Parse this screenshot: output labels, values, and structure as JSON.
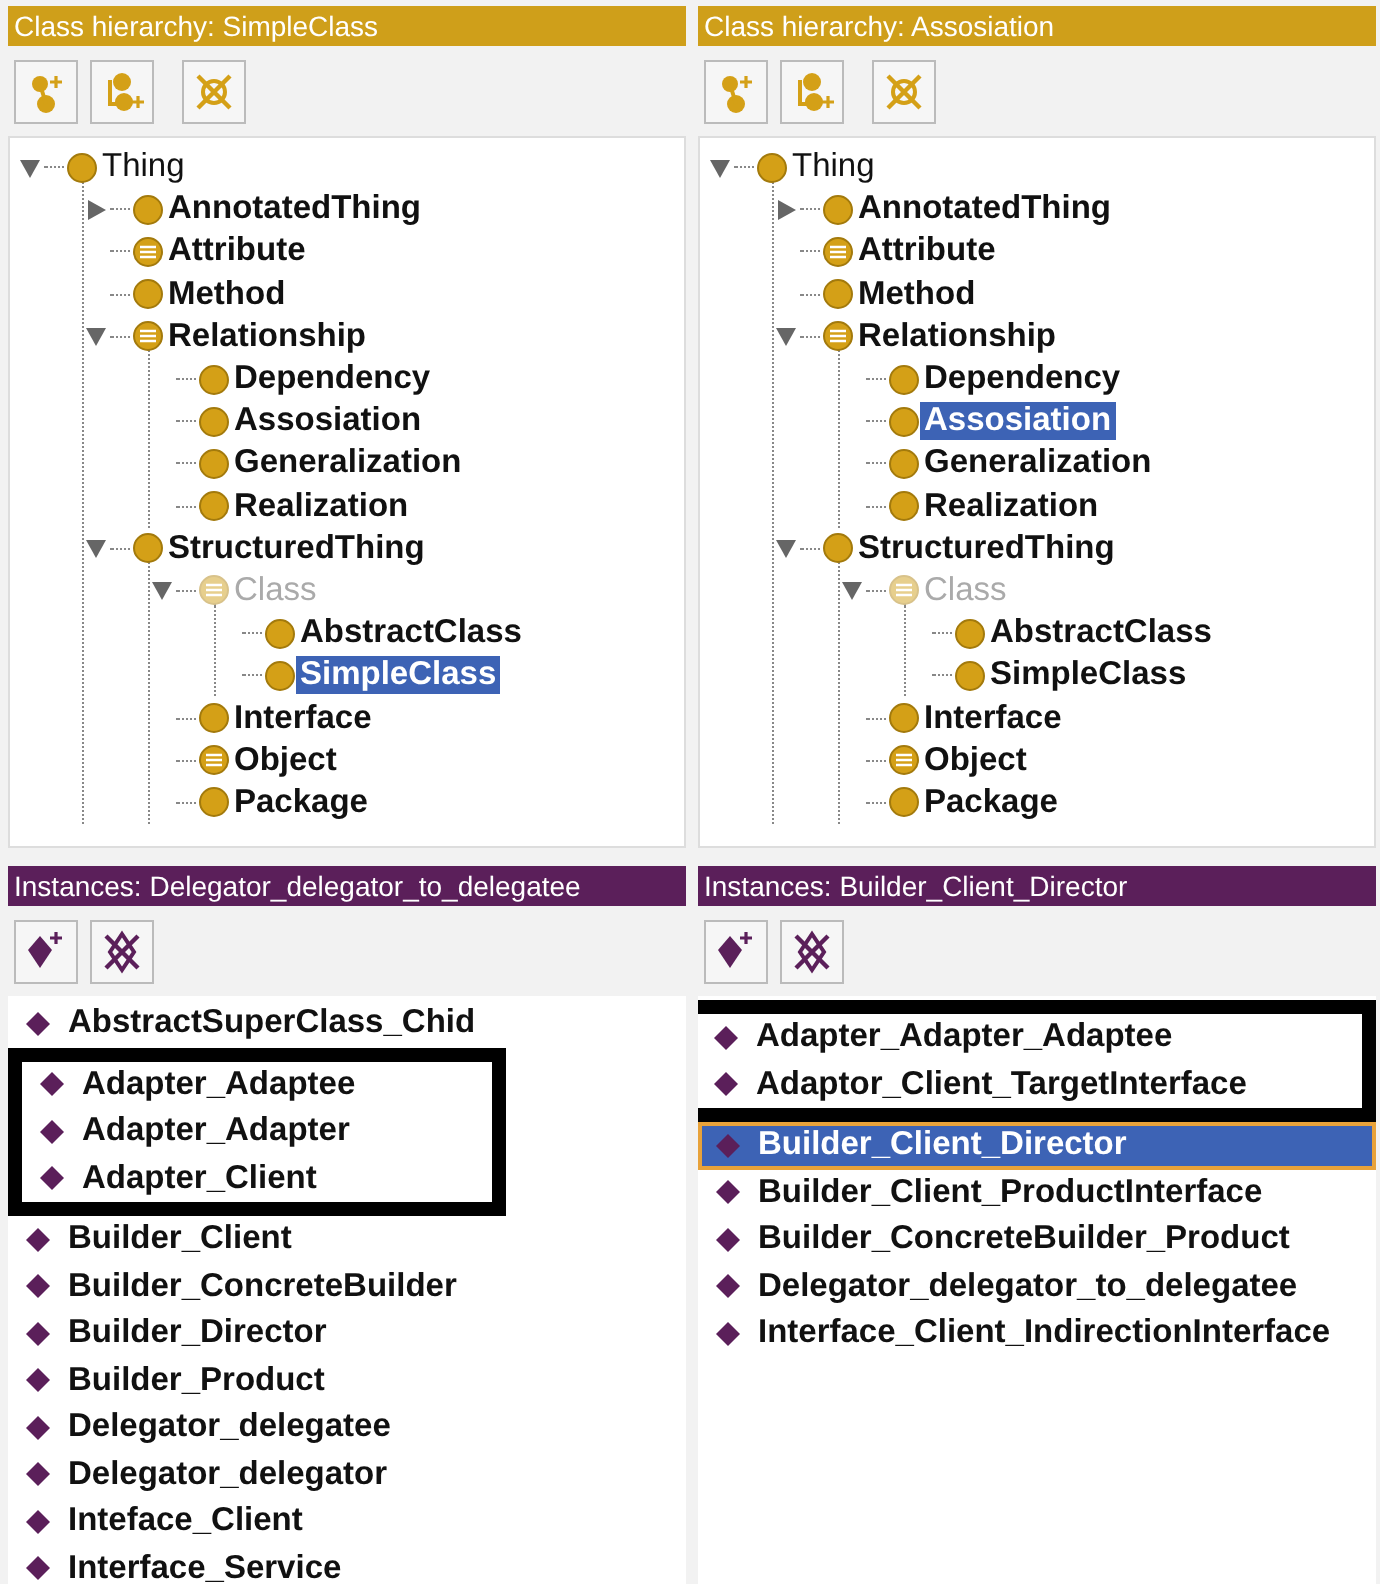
{
  "hierarchy_panels": [
    {
      "title": "Class hierarchy: SimpleClass",
      "tree": [
        {
          "label": "Thing",
          "kind": "class",
          "bold": false,
          "expanded": true,
          "selected": false,
          "greyed": false,
          "children": [
            {
              "label": "AnnotatedThing",
              "kind": "class",
              "bold": true,
              "expanded": false,
              "selected": false,
              "greyed": false
            },
            {
              "label": "Attribute",
              "kind": "defined",
              "bold": true,
              "selected": false,
              "greyed": false
            },
            {
              "label": "Method",
              "kind": "class",
              "bold": true,
              "selected": false,
              "greyed": false
            },
            {
              "label": "Relationship",
              "kind": "defined",
              "bold": true,
              "expanded": true,
              "selected": false,
              "greyed": false,
              "children": [
                {
                  "label": "Dependency",
                  "kind": "class",
                  "bold": true,
                  "selected": false,
                  "greyed": false
                },
                {
                  "label": "Assosiation",
                  "kind": "class",
                  "bold": true,
                  "selected": false,
                  "greyed": false
                },
                {
                  "label": "Generalization",
                  "kind": "class",
                  "bold": true,
                  "selected": false,
                  "greyed": false
                },
                {
                  "label": "Realization",
                  "kind": "class",
                  "bold": true,
                  "selected": false,
                  "greyed": false
                }
              ]
            },
            {
              "label": "StructuredThing",
              "kind": "class",
              "bold": true,
              "expanded": true,
              "selected": false,
              "greyed": false,
              "children": [
                {
                  "label": "Class",
                  "kind": "defined",
                  "bold": false,
                  "expanded": true,
                  "selected": false,
                  "greyed": true,
                  "children": [
                    {
                      "label": "AbstractClass",
                      "kind": "class",
                      "bold": true,
                      "selected": false,
                      "greyed": false
                    },
                    {
                      "label": "SimpleClass",
                      "kind": "class",
                      "bold": true,
                      "selected": true,
                      "greyed": false
                    }
                  ]
                },
                {
                  "label": "Interface",
                  "kind": "class",
                  "bold": true,
                  "selected": false,
                  "greyed": false
                },
                {
                  "label": "Object",
                  "kind": "defined",
                  "bold": true,
                  "selected": false,
                  "greyed": false
                },
                {
                  "label": "Package",
                  "kind": "class",
                  "bold": true,
                  "selected": false,
                  "greyed": false
                }
              ]
            }
          ]
        }
      ]
    },
    {
      "title": "Class hierarchy: Assosiation",
      "tree": [
        {
          "label": "Thing",
          "kind": "class",
          "bold": false,
          "expanded": true,
          "selected": false,
          "greyed": false,
          "children": [
            {
              "label": "AnnotatedThing",
              "kind": "class",
              "bold": true,
              "expanded": false,
              "selected": false,
              "greyed": false
            },
            {
              "label": "Attribute",
              "kind": "defined",
              "bold": true,
              "selected": false,
              "greyed": false
            },
            {
              "label": "Method",
              "kind": "class",
              "bold": true,
              "selected": false,
              "greyed": false
            },
            {
              "label": "Relationship",
              "kind": "defined",
              "bold": true,
              "expanded": true,
              "selected": false,
              "greyed": false,
              "children": [
                {
                  "label": "Dependency",
                  "kind": "class",
                  "bold": true,
                  "selected": false,
                  "greyed": false
                },
                {
                  "label": "Assosiation",
                  "kind": "class",
                  "bold": true,
                  "selected": true,
                  "greyed": false
                },
                {
                  "label": "Generalization",
                  "kind": "class",
                  "bold": true,
                  "selected": false,
                  "greyed": false
                },
                {
                  "label": "Realization",
                  "kind": "class",
                  "bold": true,
                  "selected": false,
                  "greyed": false
                }
              ]
            },
            {
              "label": "StructuredThing",
              "kind": "class",
              "bold": true,
              "expanded": true,
              "selected": false,
              "greyed": false,
              "children": [
                {
                  "label": "Class",
                  "kind": "defined",
                  "bold": false,
                  "expanded": true,
                  "selected": false,
                  "greyed": true,
                  "children": [
                    {
                      "label": "AbstractClass",
                      "kind": "class",
                      "bold": true,
                      "selected": false,
                      "greyed": false
                    },
                    {
                      "label": "SimpleClass",
                      "kind": "class",
                      "bold": true,
                      "selected": false,
                      "greyed": false
                    }
                  ]
                },
                {
                  "label": "Interface",
                  "kind": "class",
                  "bold": true,
                  "selected": false,
                  "greyed": false
                },
                {
                  "label": "Object",
                  "kind": "defined",
                  "bold": true,
                  "selected": false,
                  "greyed": false
                },
                {
                  "label": "Package",
                  "kind": "class",
                  "bold": true,
                  "selected": false,
                  "greyed": false
                }
              ]
            }
          ]
        }
      ]
    }
  ],
  "instance_panels": [
    {
      "title": "Instances: Delegator_delegator_to_delegatee",
      "items": [
        {
          "label": "AbstractSuperClass_Chid",
          "selected": false,
          "framed": false
        },
        {
          "label": "Adapter_Adaptee",
          "selected": false,
          "framed": true
        },
        {
          "label": "Adapter_Adapter",
          "selected": false,
          "framed": true
        },
        {
          "label": "Adapter_Client",
          "selected": false,
          "framed": true
        },
        {
          "label": "Builder_Client",
          "selected": false,
          "framed": false
        },
        {
          "label": "Builder_ConcreteBuilder",
          "selected": false,
          "framed": false
        },
        {
          "label": "Builder_Director",
          "selected": false,
          "framed": false
        },
        {
          "label": "Builder_Product",
          "selected": false,
          "framed": false
        },
        {
          "label": "Delegator_delegatee",
          "selected": false,
          "framed": false
        },
        {
          "label": "Delegator_delegator",
          "selected": false,
          "framed": false
        },
        {
          "label": "Inteface_Client",
          "selected": false,
          "framed": false
        },
        {
          "label": "Interface_Service",
          "selected": false,
          "framed": false
        }
      ]
    },
    {
      "title": "Instances: Builder_Client_Director",
      "items": [
        {
          "label": "Adapter_Adapter_Adaptee",
          "selected": false,
          "framed": true
        },
        {
          "label": "Adaptor_Client_TargetInterface",
          "selected": false,
          "framed": true
        },
        {
          "label": "Builder_Client_Director",
          "selected": true,
          "framed": false
        },
        {
          "label": "Builder_Client_ProductInterface",
          "selected": false,
          "framed": false
        },
        {
          "label": "Builder_ConcreteBuilder_Product",
          "selected": false,
          "framed": false
        },
        {
          "label": "Delegator_delegator_to_delegatee",
          "selected": false,
          "framed": false
        },
        {
          "label": "Interface_Client_IndirectionInterface",
          "selected": false,
          "framed": false
        }
      ]
    }
  ]
}
